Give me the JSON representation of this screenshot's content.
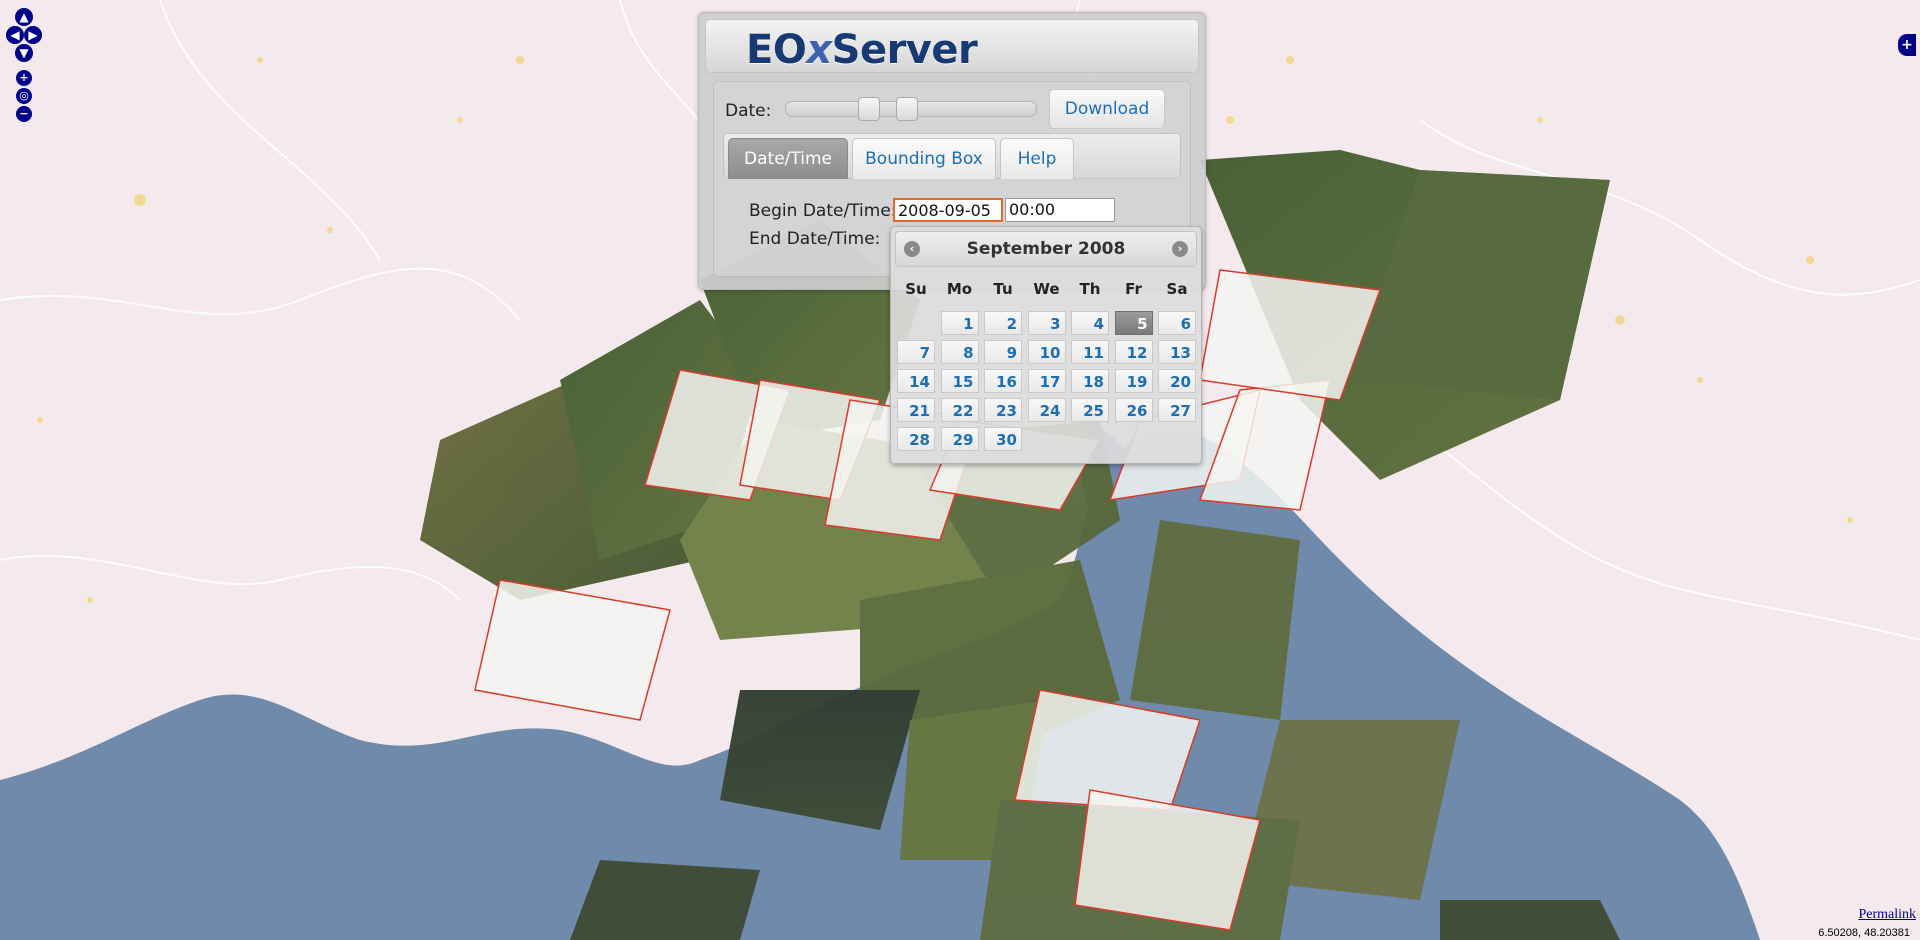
{
  "app": {
    "logo": {
      "prefix": "EO",
      "x": "x",
      "suffix": "Server"
    }
  },
  "controls": {
    "pan_up": "▲",
    "pan_left": "◀",
    "pan_right": "▶",
    "pan_down": "▼",
    "zoom_in": "+",
    "zoom_world": "◎",
    "zoom_out": "−",
    "layer_switcher": "+"
  },
  "panel": {
    "date_label": "Date:",
    "download_label": "Download",
    "tabs": [
      {
        "label": "Date/Time",
        "active": true
      },
      {
        "label": "Bounding Box",
        "active": false
      },
      {
        "label": "Help",
        "active": false
      }
    ],
    "begin_label": "Begin Date/Time:",
    "begin_date": "2008-09-05",
    "begin_time": "00:00",
    "end_label": "End Date/Time:"
  },
  "datepicker": {
    "title": "September 2008",
    "prev": "‹",
    "next": "›",
    "weekdays": [
      "Su",
      "Mo",
      "Tu",
      "We",
      "Th",
      "Fr",
      "Sa"
    ],
    "first_weekday_index": 1,
    "days_in_month": 30,
    "selected_day": 5
  },
  "footer": {
    "permalink": "Permalink",
    "coordinates": "6.50208, 48.20381"
  },
  "colors": {
    "land": "#f4eaee",
    "sea": "#6f8aab",
    "footprint": "#d93a2a",
    "accent": "#1c6fb7"
  }
}
